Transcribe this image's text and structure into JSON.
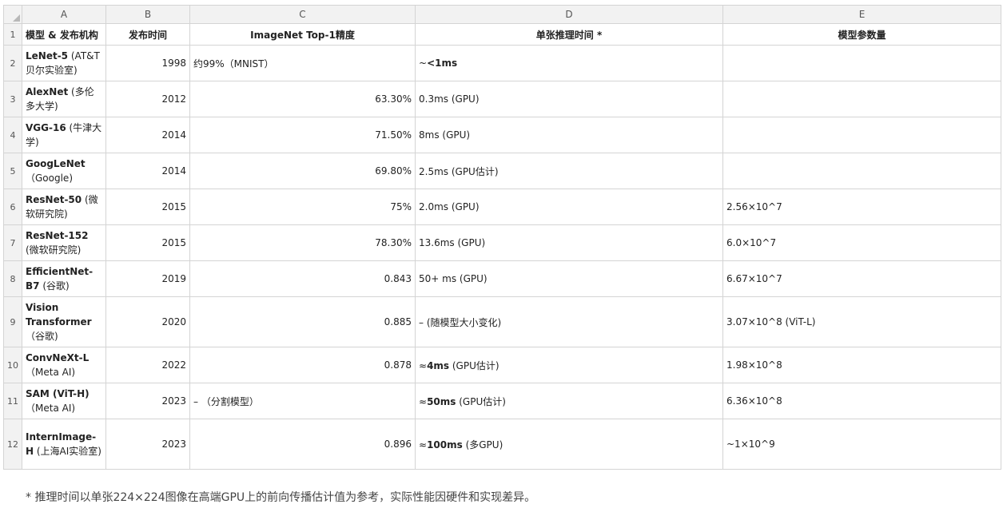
{
  "columns": [
    "A",
    "B",
    "C",
    "D",
    "E"
  ],
  "header": {
    "row_number": "1",
    "model": "模型 & 发布机构",
    "year": "发布时间",
    "accuracy": "ImageNet Top-1精度",
    "inference": "单张推理时间 *",
    "params": "模型参数量"
  },
  "rows": [
    {
      "n": "2",
      "model": "LeNet-5",
      "org": " (AT&T贝尔实验室)",
      "year": "1998",
      "acc": "约99%（MNIST）",
      "acc_align": "left",
      "inf_pre": "~",
      "inf_bold": "<1ms",
      "inf_post": "",
      "params": ""
    },
    {
      "n": "3",
      "model": "AlexNet",
      "org": " (多伦多大学)",
      "year": "2012",
      "acc": "63.30%",
      "acc_align": "right",
      "inf_pre": "",
      "inf_bold": "",
      "inf_post": "0.3ms (GPU)",
      "params": ""
    },
    {
      "n": "4",
      "model": "VGG-16",
      "org": " (牛津大学)",
      "year": "2014",
      "acc": "71.50%",
      "acc_align": "right",
      "inf_pre": "",
      "inf_bold": "",
      "inf_post": "8ms (GPU)",
      "params": ""
    },
    {
      "n": "5",
      "model": "GoogLeNet",
      "org": "（Google)",
      "year": "2014",
      "acc": "69.80%",
      "acc_align": "right",
      "inf_pre": "",
      "inf_bold": "",
      "inf_post": "2.5ms (GPU估计)",
      "params": ""
    },
    {
      "n": "6",
      "model": "ResNet-50",
      "org": " (微软研究院)",
      "year": "2015",
      "acc": "75%",
      "acc_align": "right",
      "inf_pre": "",
      "inf_bold": "",
      "inf_post": "2.0ms (GPU)",
      "params": "2.56×10^7"
    },
    {
      "n": "7",
      "model": "ResNet-152",
      "org": " (微软研究院)",
      "year": "2015",
      "acc": "78.30%",
      "acc_align": "right",
      "inf_pre": "",
      "inf_bold": "",
      "inf_post": "13.6ms (GPU)",
      "params": "6.0×10^7"
    },
    {
      "n": "8",
      "model": "EfficientNet-B7",
      "org": " (谷歌)",
      "year": "2019",
      "acc": "0.843",
      "acc_align": "right",
      "inf_pre": "",
      "inf_bold": "",
      "inf_post": "50+ ms (GPU)",
      "params": "6.67×10^7"
    },
    {
      "n": "9",
      "model": "Vision Transformer",
      "org": "（谷歌)",
      "year": "2020",
      "acc": "0.885",
      "acc_align": "right",
      "inf_pre": "",
      "inf_bold": "",
      "inf_post": "– (随模型大小变化)",
      "params": "3.07×10^8 (ViT-L)"
    },
    {
      "n": "10",
      "model": "ConvNeXt-L",
      "org": "（Meta AI)",
      "year": "2022",
      "acc": "0.878",
      "acc_align": "right",
      "inf_pre": "≈",
      "inf_bold": "4ms",
      "inf_post": " (GPU估计)",
      "params": "1.98×10^8"
    },
    {
      "n": "11",
      "model": "SAM (ViT-H)",
      "org": "（Meta AI)",
      "year": "2023",
      "acc": "– （分割模型）",
      "acc_align": "left",
      "inf_pre": "≈",
      "inf_bold": "50ms",
      "inf_post": " (GPU估计)",
      "params": "6.36×10^8"
    },
    {
      "n": "12",
      "model": "InternImage-H",
      "org": " (上海AI实验室)",
      "year": "2023",
      "acc": "0.896",
      "acc_align": "right",
      "inf_pre": "≈",
      "inf_bold": "100ms",
      "inf_post": " (多GPU)",
      "params": "~1×10^9"
    }
  ],
  "footnote": "* 推理时间以单张224×224图像在高端GPU上的前向传播估计值为参考，实际性能因硬件和实现差异。"
}
